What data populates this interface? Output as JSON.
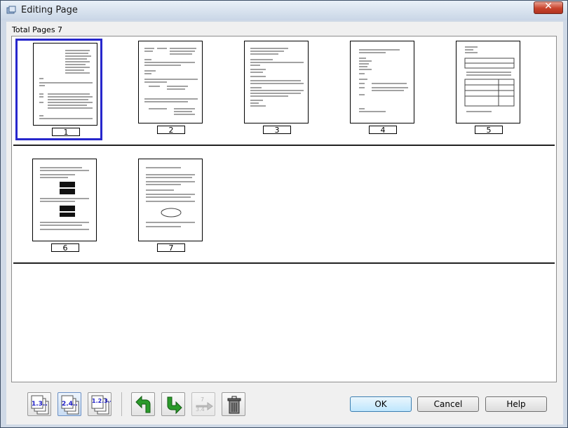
{
  "window": {
    "title": "Editing Page",
    "close_symbol": "✕"
  },
  "total_pages_label": "Total Pages 7",
  "pages": [
    {
      "number": "1",
      "selected": true
    },
    {
      "number": "2",
      "selected": false
    },
    {
      "number": "3",
      "selected": false
    },
    {
      "number": "4",
      "selected": false
    },
    {
      "number": "5",
      "selected": false
    },
    {
      "number": "6",
      "selected": false
    },
    {
      "number": "7",
      "selected": false
    }
  ],
  "toolbar": {
    "odd_pages_label": "1.3..",
    "even_pages_label": "2.4..",
    "all_pages_label": "1.2.3.4..",
    "icons": [
      "odd-pages-icon",
      "even-pages-icon",
      "all-pages-icon",
      "rotate-left-icon",
      "rotate-right-icon",
      "reorder-pages-icon",
      "trash-icon"
    ]
  },
  "buttons": {
    "ok": "OK",
    "cancel": "Cancel",
    "help": "Help"
  },
  "colors": {
    "selection_border": "#2727cc",
    "rotate_arrow": "#2a9a2a",
    "page_label_text": "#2020c8"
  }
}
